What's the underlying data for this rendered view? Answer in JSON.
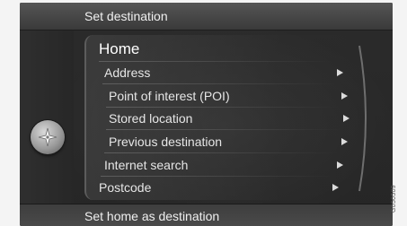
{
  "header": {
    "title": "Set destination"
  },
  "menu": {
    "items": [
      {
        "label": "Home",
        "has_submenu": false,
        "selected": true
      },
      {
        "label": "Address",
        "has_submenu": true
      },
      {
        "label": "Point of interest (POI)",
        "has_submenu": true
      },
      {
        "label": "Stored location",
        "has_submenu": true
      },
      {
        "label": "Previous destination",
        "has_submenu": true
      },
      {
        "label": "Internet search",
        "has_submenu": true
      },
      {
        "label": "Postcode",
        "has_submenu": true
      }
    ]
  },
  "footer": {
    "text": "Set home as destination"
  },
  "figure_code": "G050509",
  "colors": {
    "background": "#2a2a2a",
    "header": "#4a4a4a",
    "text": "#e6e6e6"
  },
  "icons": {
    "knob": "navigation-knob-icon",
    "arrow": "chevron-right-icon"
  }
}
